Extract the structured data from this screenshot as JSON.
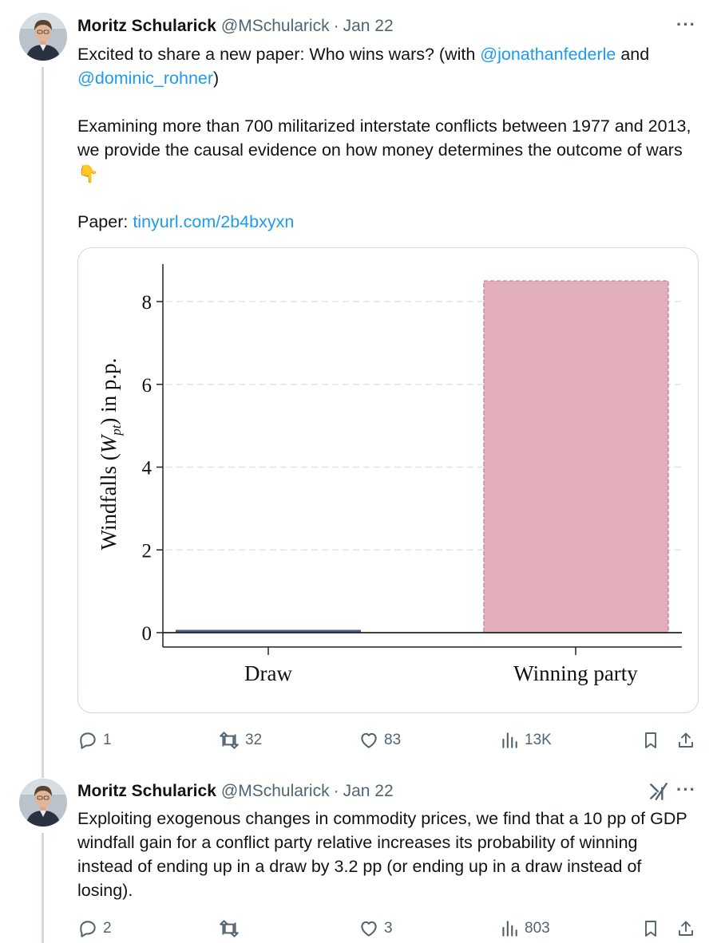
{
  "tweet1": {
    "name": "Moritz Schularick",
    "handle": "@MSchularick",
    "separator": "·",
    "date": "Jan 22",
    "more": "···",
    "line1_pre": "Excited to share a new paper: Who wins wars? (with ",
    "mention1": "@jonathanfederle",
    "line1_post": " and",
    "mention2": "@dominic_rohner",
    "line2_post": ")",
    "para2": "Examining more than 700 militarized interstate conflicts between 1977 and 2013, we provide the causal evidence on how money determines the outcome of wars",
    "emoji": "👇",
    "paper_label": "Paper: ",
    "paper_link": "tinyurl.com/2b4bxyxn",
    "stats": {
      "replies": "1",
      "reposts": "32",
      "likes": "83",
      "views": "13K"
    }
  },
  "tweet2": {
    "name": "Moritz Schularick",
    "handle": "@MSchularick",
    "separator": "·",
    "date": "Jan 22",
    "more": "···",
    "text": "Exploiting exogenous changes in commodity prices, we find that a 10 pp of GDP windfall gain for a conflict party relative increases its probability of winning instead of ending up in a draw by 3.2 pp (or ending up in a draw instead of losing).",
    "stats": {
      "replies": "2",
      "reposts": "",
      "likes": "3",
      "views": "803"
    }
  },
  "chart_data": {
    "type": "bar",
    "categories": [
      "Draw",
      "Winning party"
    ],
    "values": [
      0.0,
      8.5
    ],
    "title": "",
    "xlabel": "",
    "ylabel_pre": "Windfalls (",
    "ylabel_var": "W",
    "ylabel_sub": "pt",
    "ylabel_post": ") in p.p.",
    "ylim": [
      0,
      9.1
    ],
    "yticks": [
      "0",
      "2",
      "4",
      "6",
      "8"
    ],
    "ytick_values": [
      0,
      2,
      4,
      6,
      8
    ],
    "grid": "dashed-horizontal",
    "colors": {
      "draw": "#4c5b8c",
      "winning": "#e3aebb",
      "winning_edge": "#c98a9c"
    }
  },
  "icons": [
    "reply-icon",
    "repost-icon",
    "like-icon",
    "views-icon",
    "bookmark-icon",
    "share-icon",
    "more-icon",
    "grok-icon"
  ]
}
